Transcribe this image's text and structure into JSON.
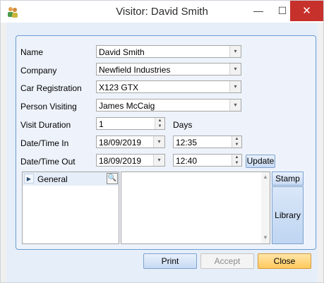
{
  "window": {
    "title": "Visitor: David Smith"
  },
  "titlebar_buttons": {
    "minimize": "—",
    "maximize": "☐",
    "close": "✕"
  },
  "form": {
    "name_label": "Name",
    "name_value": "David Smith",
    "company_label": "Company",
    "company_value": "Newfield Industries",
    "car_label": "Car Registration",
    "car_value": "X123 GTX",
    "person_label": "Person Visiting",
    "person_value": "James McCaig",
    "duration_label": "Visit Duration",
    "duration_value": "1",
    "duration_unit": "Days",
    "datetime_in_label": "Date/Time In",
    "date_in": "18/09/2019",
    "time_in": "12:35",
    "datetime_out_label": "Date/Time Out",
    "date_out": "18/09/2019",
    "time_out": "12:40",
    "update_label": "Update"
  },
  "panel": {
    "tree_header": "General",
    "stamp_label": "Stamp",
    "library_label": "Library"
  },
  "buttons": {
    "print": "Print",
    "accept": "Accept",
    "close": "Close"
  },
  "colors": {
    "close_button": "#c7312c",
    "accent": "#6c9bd2",
    "default_button": "#ffc95e"
  },
  "icons": {
    "dropdown": "▾",
    "spin_up": "▲",
    "spin_down": "▼",
    "expander": "▶",
    "zoom": "🔍"
  }
}
